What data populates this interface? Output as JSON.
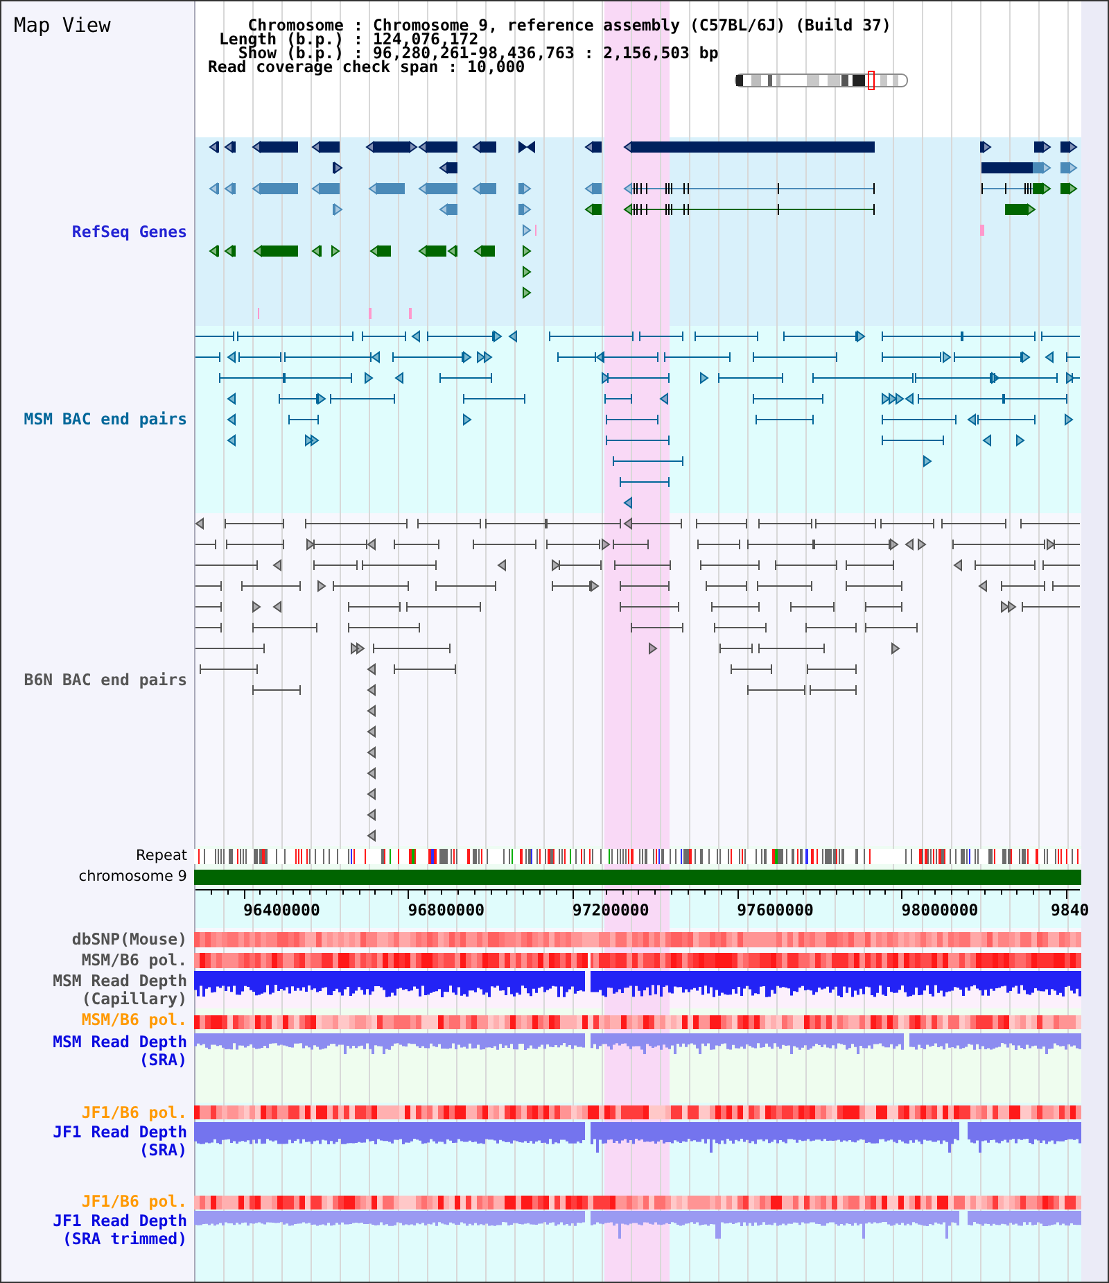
{
  "title": "Map View",
  "info": [
    {
      "label": "Chromosome",
      "separator": ":",
      "value": "Chromosome 9, reference assembly (C57BL/6J) (Build 37)"
    },
    {
      "label": "Length (b.p.)",
      "separator": ":",
      "value": "124,076,172"
    },
    {
      "label": "Show (b.p.)",
      "separator": ":",
      "value": "96,280,261-98,436,763 : 2,156,503 bp"
    }
  ],
  "coverage_span": {
    "label": "Read coverage check span",
    "separator": ":",
    "value": "10,000"
  },
  "feature_tracks": [
    {
      "label": "RefSeq Genes",
      "color": "#2323d4",
      "kind": "genes"
    },
    {
      "label": "MSM BAC end pairs",
      "color": "#006699",
      "kind": "bac_pairs"
    },
    {
      "label": "B6N BAC end pairs",
      "color": "#555555",
      "kind": "bac_pairs"
    }
  ],
  "reference_tracks": [
    {
      "label": "Repeat",
      "kind": "repeat"
    },
    {
      "label": "chromosome 9",
      "kind": "chromosome"
    }
  ],
  "axis": {
    "ticks": [
      "96400000",
      "96800000",
      "97200000",
      "97600000",
      "98000000",
      "9840"
    ]
  },
  "data_tracks": [
    {
      "label": "dbSNP(Mouse)",
      "color": "#505050",
      "kind": "polymorphism"
    },
    {
      "label": "MSM/B6 pol.",
      "color": "#505050",
      "kind": "polymorphism"
    },
    {
      "label": "MSM Read Depth (Capillary)",
      "color": "#505050",
      "kind": "read_depth"
    },
    {
      "label": "MSM/B6 pol.",
      "color": "#ff9900",
      "kind": "polymorphism"
    },
    {
      "label": "MSM Read Depth (SRA)",
      "color": "#0a0ae0",
      "kind": "read_depth"
    },
    {
      "label": "JF1/B6 pol.",
      "color": "#ff9900",
      "kind": "polymorphism"
    },
    {
      "label": "JF1 Read Depth (SRA)",
      "color": "#0a0ae0",
      "kind": "read_depth"
    },
    {
      "label": "JF1/B6 pol.",
      "color": "#ff9900",
      "kind": "polymorphism"
    },
    {
      "label": "JF1 Read Depth (SRA trimmed)",
      "color": "#0a0ae0",
      "kind": "read_depth"
    }
  ]
}
